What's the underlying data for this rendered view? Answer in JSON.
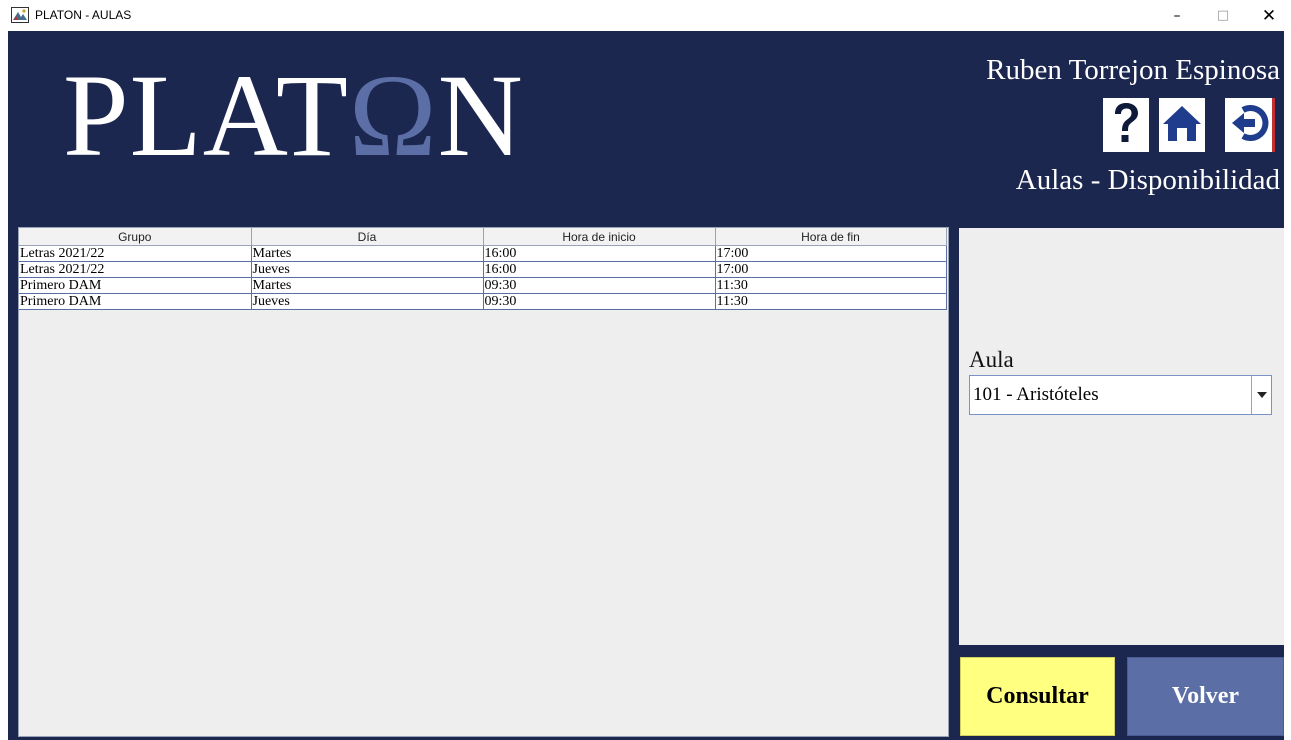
{
  "window": {
    "title": "PLATON - AULAS",
    "minimize_label": "–",
    "maximize_label": "□",
    "close_label": "✕"
  },
  "header": {
    "logo_prefix": "PLAT",
    "logo_omega": "Ω",
    "logo_suffix": "N",
    "user_name": "Ruben Torrejon Espinosa",
    "section_title": "Aulas - Disponibilidad",
    "icons": [
      "help-icon",
      "home-icon",
      "logout-icon"
    ]
  },
  "table": {
    "columns": [
      "Grupo",
      "Día",
      "Hora de inicio",
      "Hora de fin"
    ],
    "rows": [
      [
        "Letras 2021/22",
        "Martes",
        "16:00",
        "17:00"
      ],
      [
        "Letras 2021/22",
        "Jueves",
        "16:00",
        "17:00"
      ],
      [
        "Primero DAM",
        "Martes",
        "09:30",
        "11:30"
      ],
      [
        "Primero DAM",
        "Jueves",
        "09:30",
        "11:30"
      ]
    ]
  },
  "form": {
    "aula_label": "Aula",
    "aula_selected": "101 - Aristóteles"
  },
  "buttons": {
    "consultar": "Consultar",
    "volver": "Volver"
  },
  "colors": {
    "background": "#1c2750",
    "accent": "#5b6ea6",
    "consultar_bg": "#ffff80",
    "panel_bg": "#eeeeee"
  }
}
